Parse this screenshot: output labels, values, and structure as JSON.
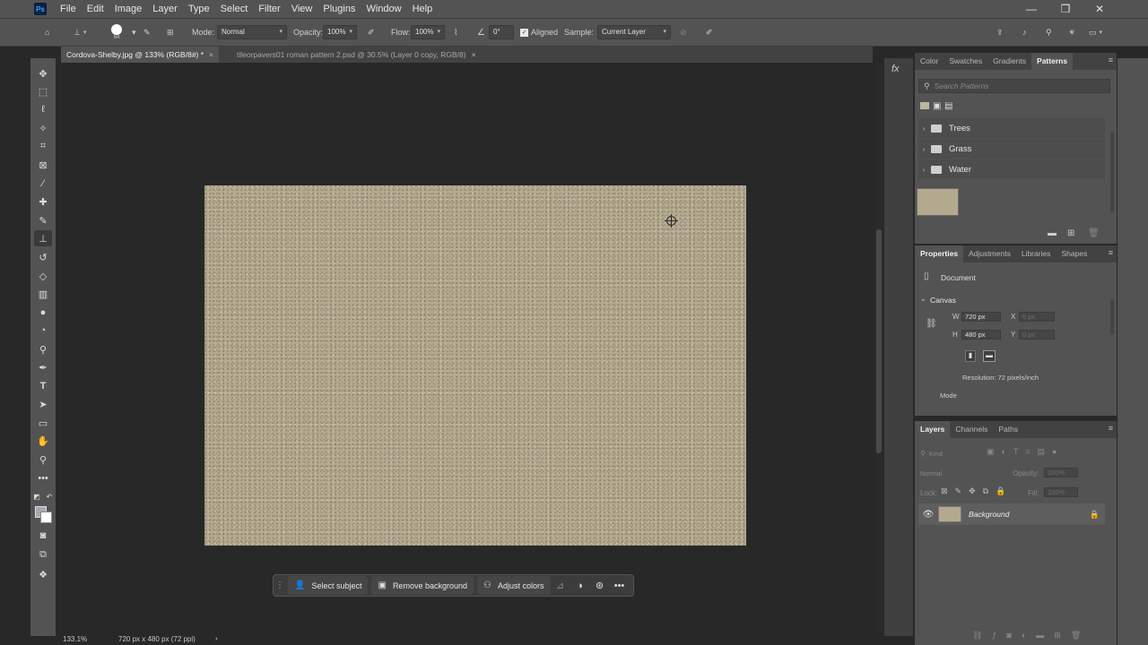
{
  "app": {
    "logo": "Ps"
  },
  "menu": [
    "File",
    "Edit",
    "Image",
    "Layer",
    "Type",
    "Select",
    "Filter",
    "View",
    "Plugins",
    "Window",
    "Help"
  ],
  "window_controls": {
    "minimize": "—",
    "maximize": "❐",
    "close": "✕"
  },
  "options": {
    "brush_size": "64",
    "mode_label": "Mode:",
    "mode_value": "Normal",
    "opacity_label": "Opacity:",
    "opacity_value": "100%",
    "flow_label": "Flow:",
    "flow_value": "100%",
    "angle_value": "0°",
    "aligned_label": "Aligned",
    "aligned_checked": true,
    "sample_label": "Sample:",
    "sample_value": "Current Layer"
  },
  "tabs": [
    {
      "label": "Cordova-Shelby.jpg @ 133% (RGB/8#) *",
      "active": true
    },
    {
      "label": "tileorpavers01 roman pattern 2.psd @ 30.5% (Layer 0 copy, RGB/8)",
      "active": false
    }
  ],
  "taskbar": {
    "select_subject": "Select subject",
    "remove_background": "Remove background",
    "adjust_colors": "Adjust colors"
  },
  "status": {
    "zoom": "133.1%",
    "doc_size": "720 px x 480 px (72 ppi)"
  },
  "patterns_panel": {
    "tabs": [
      "Color",
      "Swatches",
      "Gradients",
      "Patterns"
    ],
    "active_tab": "Patterns",
    "search_placeholder": "Search Patterns",
    "folders": [
      "Trees",
      "Grass",
      "Water"
    ],
    "swatch_color": "#b3a98f"
  },
  "properties_panel": {
    "tabs": [
      "Properties",
      "Adjustments",
      "Libraries",
      "Shapes"
    ],
    "active_tab": "Properties",
    "doc_label": "Document",
    "section": "Canvas",
    "w_label": "W",
    "w_value": "720 px",
    "h_label": "H",
    "h_value": "480 px",
    "x_label": "X",
    "x_value": "0 px",
    "y_label": "Y",
    "y_value": "0 px",
    "resolution": "Resolution: 72 pixels/inch",
    "mode_label": "Mode"
  },
  "layers_panel": {
    "tabs": [
      "Layers",
      "Channels",
      "Paths"
    ],
    "active_tab": "Layers",
    "kind_placeholder": "Kind",
    "blend_mode": "Normal",
    "opacity_label": "Opacity:",
    "opacity_value": "100%",
    "lock_label": "Lock:",
    "fill_label": "Fill:",
    "fill_value": "100%",
    "layers": [
      {
        "name": "Background",
        "visible": true,
        "locked": true
      }
    ]
  },
  "colors": {
    "canvas": "#b3a98f",
    "foreground": "#a5a9b6",
    "background": "#ffffff",
    "ui_panel": "#535353",
    "workspace": "#282828"
  }
}
